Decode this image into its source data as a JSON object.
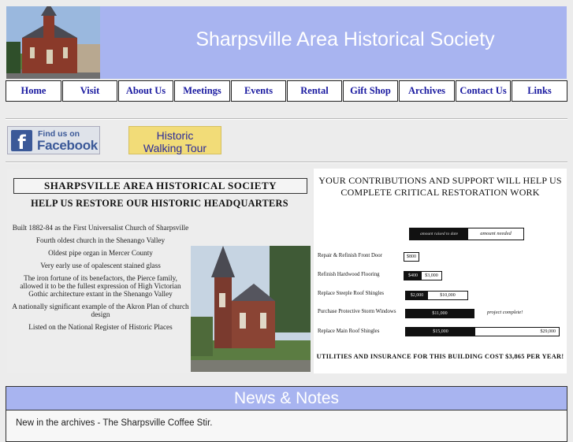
{
  "header": {
    "title": "Sharpsville Area Historical Society",
    "photo_alt": "church-photo"
  },
  "nav": {
    "items": [
      {
        "label": "Home"
      },
      {
        "label": "Visit"
      },
      {
        "label": "About Us"
      },
      {
        "label": "Meetings"
      },
      {
        "label": "Events"
      },
      {
        "label": "Rental"
      },
      {
        "label": "Gift Shop"
      },
      {
        "label": "Archives"
      },
      {
        "label": "Contact Us"
      },
      {
        "label": "Links"
      }
    ]
  },
  "social": {
    "facebook_find": "Find us on",
    "facebook_name": "Facebook",
    "tour_line1": "Historic",
    "tour_line2": "Walking Tour"
  },
  "poster": {
    "title": "SHARPSVILLE AREA HISTORICAL SOCIETY",
    "subtitle": "HELP US RESTORE OUR HISTORIC HEADQUARTERS",
    "facts": [
      "Built 1882-84 as the First Universalist Church of Sharpsville",
      "Fourth oldest church in the Shenango Valley",
      "Oldest pipe organ in Mercer County",
      "Very early use of opalescent stained glass",
      "The iron fortune of its benefactors, the Pierce family, allowed it to be the fullest expression of High Victorian Gothic architecture extant in the Shenango Valley",
      "A nationally significant example of the Akron Plan of church design",
      "Listed on the National Register of Historic Places"
    ],
    "contrib_line1": "YOUR CONTRIBUTIONS AND SUPPORT WILL HELP US",
    "contrib_line2": "COMPLETE CRITICAL RESTORATION WORK",
    "legend_raised": "amount raised to date",
    "legend_needed": "amount needed",
    "projects": [
      {
        "label": "Repair & Refinish Front Door",
        "raised": "$800",
        "needed": "",
        "note": ""
      },
      {
        "label": "Refinish Hardwood Flooring",
        "raised": "$400",
        "needed": "$3,000",
        "note": ""
      },
      {
        "label": "Replace Steeple Roof Shingles",
        "raised": "$2,000",
        "needed": "$10,000",
        "note": ""
      },
      {
        "label": "Purchase Protective Storm Windows",
        "raised": "$11,000",
        "needed": "",
        "note": "project complete!"
      },
      {
        "label": "Replace Main Roof Shingles",
        "raised": "$15,000",
        "needed": "$29,000",
        "note": ""
      }
    ],
    "footer": "UTILITIES AND INSURANCE FOR THIS BUILDING COST $3,865 PER YEAR!"
  },
  "news": {
    "heading": "News & Notes",
    "item": "New in the archives - The Sharpsville Coffee Stir."
  },
  "colors": {
    "header_bg": "#a8b4f0",
    "nav_text": "#1a1aa0",
    "facebook_blue": "#3b5998",
    "tour_bg": "#f2dc78"
  }
}
